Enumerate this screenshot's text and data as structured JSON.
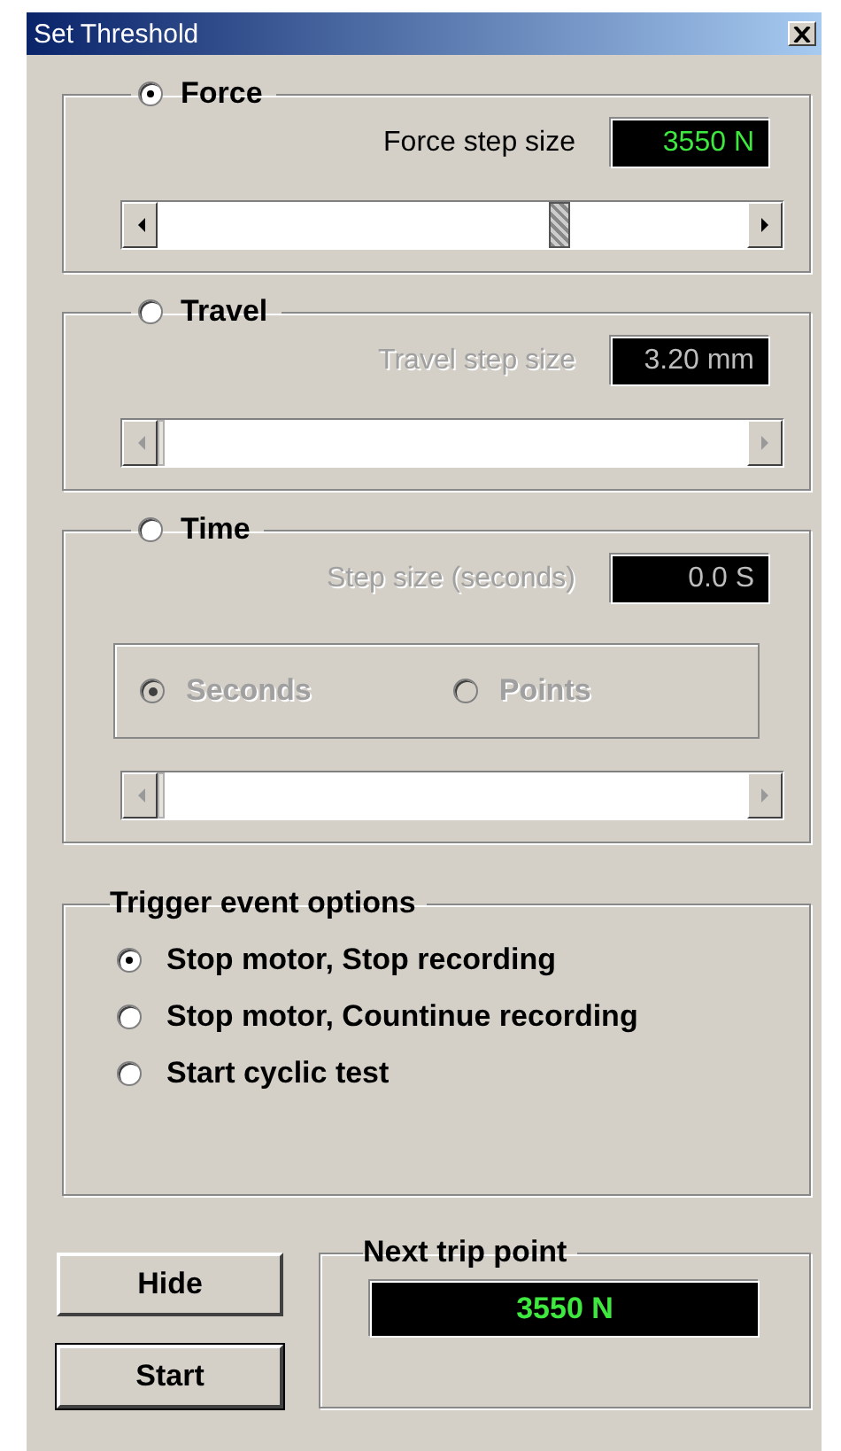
{
  "window": {
    "title": "Set Threshold"
  },
  "sections": [
    {
      "label": "Force",
      "selected": true,
      "disabled": false,
      "step_label": "Force step size",
      "step_value": "3550 N",
      "slider": {
        "level": 0.69
      }
    },
    {
      "label": "Travel",
      "selected": false,
      "disabled": true,
      "step_label": "Travel step size",
      "step_value": "3.20 mm",
      "slider": {
        "level": 0
      }
    },
    {
      "label": "Time",
      "selected": false,
      "disabled": true,
      "step_label": "Step size (seconds)",
      "step_value": "0.0 S",
      "slider": {
        "level": 0
      },
      "units": [
        {
          "label": "Seconds",
          "selected": true
        },
        {
          "label": "Points",
          "selected": false
        }
      ]
    }
  ],
  "trigger": {
    "title": "Trigger event options",
    "options": [
      {
        "label": "Stop motor, Stop recording",
        "selected": true
      },
      {
        "label": "Stop motor, Countinue recording",
        "selected": false
      },
      {
        "label": "Start cyclic test",
        "selected": false
      }
    ]
  },
  "buttons": [
    {
      "label": "Hide",
      "default": false
    },
    {
      "label": "Start",
      "default": true
    }
  ],
  "next_trip": {
    "title": "Next trip point",
    "value": "3550 N"
  }
}
